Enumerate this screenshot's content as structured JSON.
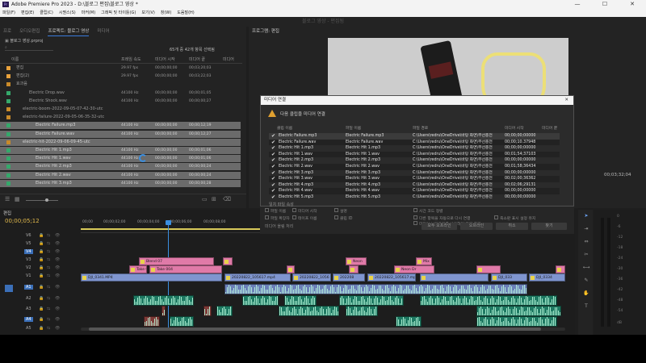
{
  "window": {
    "title": "Adobe Premiere Pro 2023 - D:\\블로그 편집\\블로그 영상 *",
    "controls": [
      "—",
      "☐",
      "✕"
    ]
  },
  "menu": [
    "파일(F)",
    "편집(E)",
    "클립(C)",
    "시퀀스(S)",
    "마커(M)",
    "그래픽 및 타이틀(G)",
    "보기(V)",
    "창(W)",
    "도움말(H)"
  ],
  "workspace_title": "블로그 영상 - 편집됨",
  "project_panel": {
    "tabs": [
      "프로",
      "오디오편집",
      "프로젝트: 블로그 영상",
      "미디어"
    ],
    "project_name": "블로그 영상.prproj",
    "item_count": "65개 중 42개 항목 선택됨",
    "columns": [
      "이름",
      "프레임 속도",
      "미디어 시작",
      "미디어 끝",
      "미디어"
    ],
    "rows": [
      {
        "name": "편집",
        "rate": "29.97 fps",
        "start": "00;00;00;00",
        "end": "00;03;20;03",
        "sel": false
      },
      {
        "name": "편집(2)",
        "rate": "29.97 fps",
        "start": "00;00;00;00",
        "end": "00;03;22;03",
        "sel": false
      },
      {
        "name": "효과음",
        "rate": "",
        "start": "",
        "end": "",
        "sel": false
      },
      {
        "name": "Electric Drop.wav",
        "rate": "44100 Hz",
        "start": "00;00;00;00",
        "end": "00;00;01;05",
        "sel": false
      },
      {
        "name": "Electric Shock.wav",
        "rate": "44100 Hz",
        "start": "00;00;00;00",
        "end": "00;00;00;27",
        "sel": false
      },
      {
        "name": "electric-boom-2022-09-05-07-42-30-utc",
        "rate": "",
        "start": "",
        "end": "",
        "sel": false
      },
      {
        "name": "electric-failure-2022-09-05-06-35-32-utc",
        "rate": "",
        "start": "",
        "end": "",
        "sel": false
      },
      {
        "name": "Electric Failure.mp3",
        "rate": "44100 Hz",
        "start": "00;00;00;00",
        "end": "00;00;12;19",
        "sel": true
      },
      {
        "name": "Electric Failure.wav",
        "rate": "44100 Hz",
        "start": "00;00;00;00",
        "end": "00;00;12;27",
        "sel": true
      },
      {
        "name": "electric-hit-2022-09-06-09-45-utc",
        "rate": "",
        "start": "",
        "end": "",
        "sel": true
      },
      {
        "name": "Electric Hit 1.mp3",
        "rate": "44100 Hz",
        "start": "00;00;00;00",
        "end": "00;00;01;06",
        "sel": true
      },
      {
        "name": "Electric Hit 1.wav",
        "rate": "44100 Hz",
        "start": "00;00;00;00",
        "end": "00;00;01;06",
        "sel": true
      },
      {
        "name": "Electric Hit 2.mp3",
        "rate": "44100 Hz",
        "start": "00;00;00;00",
        "end": "00;00;00;24",
        "sel": true
      },
      {
        "name": "Electric Hit 2.wav",
        "rate": "44100 Hz",
        "start": "00;00;00;00",
        "end": "00;00;00;24",
        "sel": true
      },
      {
        "name": "Electric Hit 3.mp3",
        "rate": "44100 Hz",
        "start": "00;00;00;00",
        "end": "00;00;00;28",
        "sel": true
      }
    ]
  },
  "program_monitor": {
    "tab": "프로그램: 편집",
    "timecode": "00;03;32;04"
  },
  "dialog": {
    "title": "미디어 연결",
    "close": "✕",
    "header": "다음 클립을 미디어 연결",
    "columns": [
      "클립 이름",
      "파일 이름",
      "파일 경로",
      "미디어 시작",
      "미디어 끝"
    ],
    "rows": [
      {
        "clip": "Electric Failure.mp3",
        "file": "Electric Failure.mp3",
        "path": "C:\\Users\\redru\\OneDrive\\바탕 화면\\무선충전",
        "start": "00;00;00;00000"
      },
      {
        "clip": "Electric Failure.wav",
        "file": "Electric Failure.wav",
        "path": "C:\\Users\\redru\\OneDrive\\바탕 화면\\무선충전",
        "start": "00;00;10.37948"
      },
      {
        "clip": "Electric Hit 1.mp3",
        "file": "Electric Hit 1.mp3",
        "path": "C:\\Users\\redru\\OneDrive\\바탕 화면\\무선충전",
        "start": "00;00;00;00000"
      },
      {
        "clip": "Electric Hit 1.wav",
        "file": "Electric Hit 1.wav",
        "path": "C:\\Users\\redru\\OneDrive\\바탕 화면\\무선충전",
        "start": "00;01;54;37103"
      },
      {
        "clip": "Electric Hit 2.mp3",
        "file": "Electric Hit 2.mp3",
        "path": "C:\\Users\\redru\\OneDrive\\바탕 화면\\무선충전",
        "start": "00;00;00;00000"
      },
      {
        "clip": "Electric Hit 2.wav",
        "file": "Electric Hit 2.wav",
        "path": "C:\\Users\\redru\\OneDrive\\바탕 화면\\무선충전",
        "start": "00;01;58;36434"
      },
      {
        "clip": "Electric Hit 3.mp3",
        "file": "Electric Hit 3.mp3",
        "path": "C:\\Users\\redru\\OneDrive\\바탕 화면\\무선충전",
        "start": "00;00;00;00000"
      },
      {
        "clip": "Electric Hit 3.wav",
        "file": "Electric Hit 3.wav",
        "path": "C:\\Users\\redru\\OneDrive\\바탕 화면\\무선충전",
        "start": "00;02;00;36362"
      },
      {
        "clip": "Electric Hit 4.mp3",
        "file": "Electric Hit 4.mp3",
        "path": "C:\\Users\\redru\\OneDrive\\바탕 화면\\무선충전",
        "start": "00;02;06;29131"
      },
      {
        "clip": "Electric Hit 4.wav",
        "file": "Electric Hit 4.wav",
        "path": "C:\\Users\\redru\\OneDrive\\바탕 화면\\무선충전",
        "start": "00;00;00;00000"
      },
      {
        "clip": "Electric Hit 5.mp3",
        "file": "Electric Hit 5.mp3",
        "path": "C:\\Users\\redru\\OneDrive\\바탕 화면\\무선충전",
        "start": "00;00;00;00000"
      }
    ],
    "match_label": "일치 파일 속성",
    "match_options": [
      "파일 이름",
      "미디어 시작",
      "설명",
      "파일 확장자",
      "테이프 이름",
      "클립 ID"
    ],
    "right_options": [
      "시간 코드 정렬",
      "다른 항목을 자동으로 다시 연결",
      "미디어 브라우저를 사용하여 파일 찾기",
      "축소판 표시 설정 유지"
    ],
    "bottom_label": "미디어 올림 처리",
    "buttons": [
      "모두 오프라인",
      "오프라인",
      "취소",
      "찾기"
    ]
  },
  "timeline": {
    "tab": "편집",
    "timecode": "00;00;05;12",
    "ruler": [
      "00;00",
      "00;00;02;00",
      "00;00;04;00",
      "00;00;06;00",
      "00;00;08;00"
    ],
    "tracks": [
      "V6",
      "V5",
      "V4",
      "V3",
      "V2",
      "V1",
      "A1",
      "A2",
      "A3",
      "A4",
      "A5"
    ],
    "clip_labels": {
      "pink_a": "Blend 07",
      "pink_b": "Take 004",
      "pink_c": "Take 01",
      "neon1": "Neon",
      "neon2": "Neon Dr",
      "mix": "Mix",
      "v1_a": "DJI_0341.MP4",
      "v1_b": "20220822_105617.mp4",
      "v1_c": "20220822_1056",
      "v1_d": "202208",
      "v1_e": "20220822_105617.mp4",
      "v1_f": "DJI_033",
      "v1_g": "DJI_0334"
    }
  },
  "audio_meter": {
    "scale": [
      "0",
      "-6",
      "-12",
      "-18",
      "-24",
      "-30",
      "-36",
      "-42",
      "-48",
      "-54"
    ],
    "footer": "dB"
  }
}
